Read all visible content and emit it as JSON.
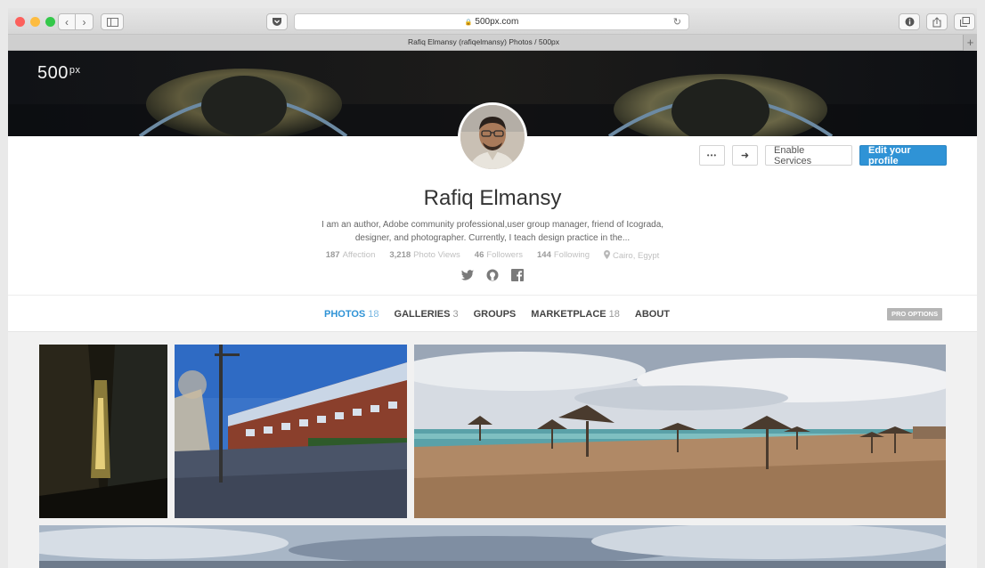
{
  "browser": {
    "url": "500px.com",
    "tab_title": "Rafiq Elmansy (rafiqelmansy) Photos / 500px",
    "new_tab_glyph": "+",
    "reload_glyph": "↻",
    "back_glyph": "‹",
    "forward_glyph": "›",
    "lock_glyph": "🔒",
    "traffic_lights": [
      "#fc605c",
      "#fdbc40",
      "#34c84a"
    ]
  },
  "site": {
    "logo": "500",
    "logo_sup": "px"
  },
  "profile": {
    "name": "Rafiq Elmansy",
    "bio": "I am an author, Adobe community professional,user group manager, friend of Icograda, designer, and photographer. Currently, I teach design practice in the...",
    "stats": [
      {
        "value": "187",
        "label": "Affection"
      },
      {
        "value": "3,218",
        "label": "Photo Views"
      },
      {
        "value": "46",
        "label": "Followers"
      },
      {
        "value": "144",
        "label": "Following"
      }
    ],
    "location": "Cairo, Egypt",
    "social": [
      "twitter-icon",
      "github-icon",
      "facebook-icon"
    ]
  },
  "actions": {
    "more_label": "•••",
    "share_label": "➜",
    "enable_services": "Enable Services",
    "edit_profile": "Edit your profile"
  },
  "tabs": [
    {
      "label": "PHOTOS",
      "count": "18",
      "active": true
    },
    {
      "label": "GALLERIES",
      "count": "3",
      "active": false
    },
    {
      "label": "GROUPS",
      "count": "",
      "active": false
    },
    {
      "label": "MARKETPLACE",
      "count": "18",
      "active": false
    },
    {
      "label": "ABOUT",
      "count": "",
      "active": false
    }
  ],
  "pro_options": "PRO OPTIONS",
  "colors": {
    "accent": "#2f93d6",
    "banner": "#0b0d10"
  }
}
